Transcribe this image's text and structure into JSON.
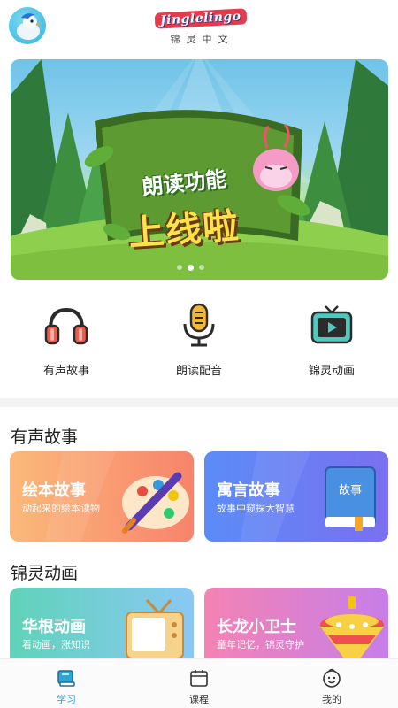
{
  "header": {
    "logo_text": "Jinglelingo",
    "logo_subtitle": "锦灵中文"
  },
  "banner": {
    "line1": "朗读功能",
    "line2": "上线啦",
    "slide_count": 3,
    "active_slide": 2
  },
  "quick_actions": [
    {
      "label": "有声故事",
      "icon": "headphones-icon"
    },
    {
      "label": "朗读配音",
      "icon": "microphone-icon"
    },
    {
      "label": "锦灵动画",
      "icon": "tv-play-icon"
    }
  ],
  "sections": [
    {
      "title": "有声故事",
      "cards": [
        {
          "title": "绘本故事",
          "subtitle": "动起来的绘本读物",
          "icon": "paint-palette-icon",
          "color_start": "#fbb97a",
          "color_end": "#f7836b"
        },
        {
          "title": "寓言故事",
          "subtitle": "故事中窥探大智慧",
          "icon": "book-icon",
          "book_label": "故事",
          "color_start": "#5b8cf7",
          "color_end": "#7a6ff0"
        }
      ]
    },
    {
      "title": "锦灵动画",
      "cards": [
        {
          "title": "华根动画",
          "subtitle": "看动画，涨知识",
          "icon": "retro-tv-icon",
          "color_start": "#5fd3b8",
          "color_end": "#8ac8f4"
        },
        {
          "title": "长龙小卫士",
          "subtitle": "童年记忆，锦灵守护",
          "icon": "spinning-top-icon",
          "color_start": "#f383b3",
          "color_end": "#c77ee8"
        }
      ]
    }
  ],
  "bottom_nav": [
    {
      "label": "学习",
      "icon": "book-stack-icon",
      "active": true
    },
    {
      "label": "课程",
      "icon": "calendar-icon",
      "active": false
    },
    {
      "label": "我的",
      "icon": "smiley-face-icon",
      "active": false
    }
  ],
  "colors": {
    "accent": "#2aa6d8",
    "divider": "#f3f3f3"
  }
}
